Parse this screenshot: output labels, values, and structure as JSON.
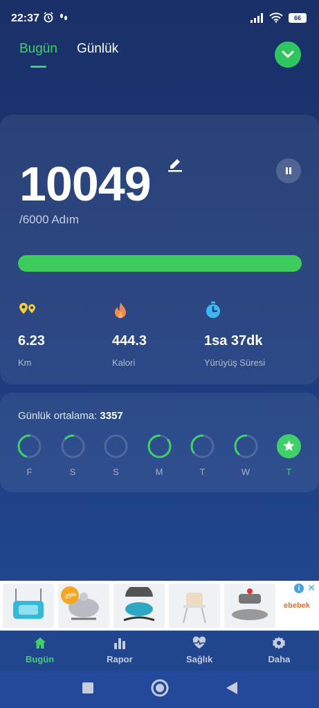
{
  "status_bar": {
    "time": "22:37",
    "battery": "66"
  },
  "top_tabs": [
    {
      "label": "Bugün",
      "active": true
    },
    {
      "label": "Günlük",
      "active": false
    }
  ],
  "steps": {
    "count": "10049",
    "goal": "/6000 Adım",
    "progress_fraction": 1.0
  },
  "stats": [
    {
      "icon": "distance-icon",
      "value": "6.23",
      "label": "Km"
    },
    {
      "icon": "flame-icon",
      "value": "444.3",
      "label": "Kalori"
    },
    {
      "icon": "stopwatch-icon",
      "value": "1sa 37dk",
      "label": "Yürüyüş Süresi"
    }
  ],
  "weekly": {
    "avg_label": "Günlük ortalama:",
    "avg_value": "3357",
    "days": [
      {
        "label": "F",
        "fraction": 0.45,
        "today": false
      },
      {
        "label": "S",
        "fraction": 0.12,
        "today": false
      },
      {
        "label": "S",
        "fraction": 0.0,
        "today": false
      },
      {
        "label": "M",
        "fraction": 0.85,
        "today": false
      },
      {
        "label": "T",
        "fraction": 0.35,
        "today": false
      },
      {
        "label": "W",
        "fraction": 0.38,
        "today": false
      },
      {
        "label": "T",
        "fraction": 1.0,
        "today": true
      }
    ]
  },
  "ad": {
    "discount": "-25%",
    "brand": "ebebek"
  },
  "bottom_nav": [
    {
      "label": "Bugün",
      "icon": "home-icon",
      "active": true
    },
    {
      "label": "Rapor",
      "icon": "bar-chart-icon",
      "active": false
    },
    {
      "label": "Sağlık",
      "icon": "heart-pulse-icon",
      "active": false
    },
    {
      "label": "Daha",
      "icon": "gear-icon",
      "active": false
    }
  ],
  "colors": {
    "accent": "#3fd06a",
    "background": "#1c3a7a",
    "distance": "#f5d033",
    "calorie": "#f5894a",
    "time": "#3db6f2"
  }
}
